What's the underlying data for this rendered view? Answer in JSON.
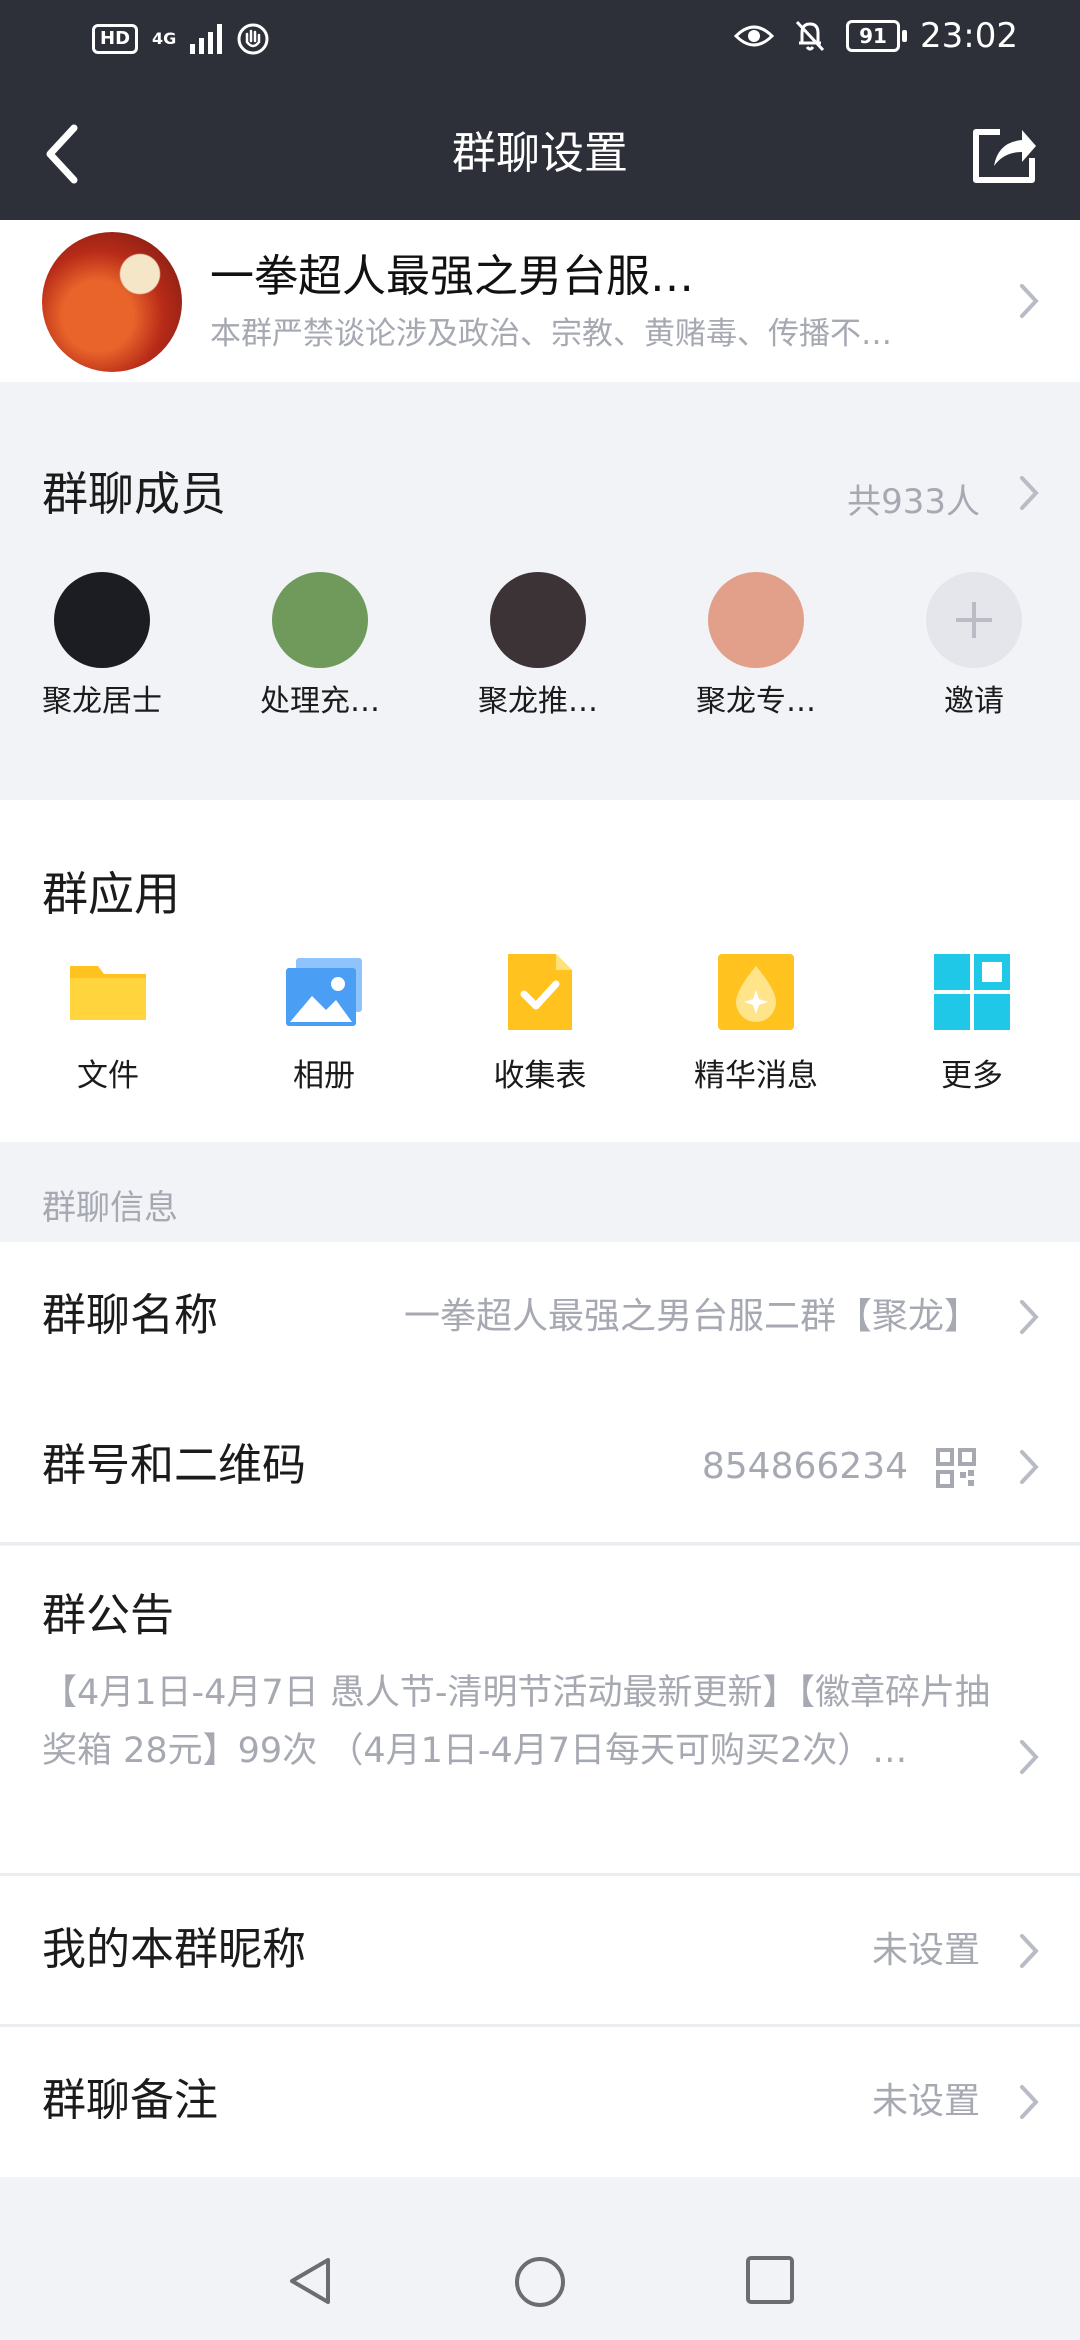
{
  "status_bar": {
    "hd_label": "HD",
    "network_label": "4G",
    "battery_level": "91",
    "time": "23:02",
    "icons": [
      "hd-icon",
      "signal-icon",
      "hand-icon",
      "eye-icon",
      "bell-mute-icon",
      "battery-icon"
    ]
  },
  "header": {
    "title": "群聊设置",
    "back_icon": "back-chevron-icon",
    "share_icon": "share-icon"
  },
  "group": {
    "name": "一拳超人最强之男台服…",
    "description": "本群严禁谈论涉及政治、宗教、黄赌毒、传播不…"
  },
  "members": {
    "label": "群聊成员",
    "count": "共933人",
    "list": [
      {
        "name": "聚龙居士",
        "color": "#1c1d22"
      },
      {
        "name": "处理充…",
        "color": "#6f9a5b"
      },
      {
        "name": "聚龙推…",
        "color": "#3b3336"
      },
      {
        "name": "聚龙专…",
        "color": "#e2a08a"
      }
    ],
    "invite_label": "邀请"
  },
  "apps": {
    "label": "群应用",
    "items": [
      {
        "name": "文件",
        "icon": "folder-icon",
        "color": "#ffc21f"
      },
      {
        "name": "相册",
        "icon": "photo-album-icon",
        "color": "#4a9ff5"
      },
      {
        "name": "收集表",
        "icon": "form-check-icon",
        "color": "#ffc21f"
      },
      {
        "name": "精华消息",
        "icon": "essence-drop-icon",
        "color": "#ffc21f"
      },
      {
        "name": "更多",
        "icon": "grid-more-icon",
        "color": "#1ec8e6"
      }
    ]
  },
  "info": {
    "caption": "群聊信息",
    "group_name_label": "群聊名称",
    "group_name_value": "一拳超人最强之男台服二群【聚龙】",
    "group_id_label": "群号和二维码",
    "group_id_value": "854866234",
    "notice_label": "群公告",
    "notice_text": "【4月1日-4月7日 愚人节-清明节活动最新更新】【徽章碎片抽奖箱 28元】99次 （4月1日-4月7日每天可购买2次）…",
    "nickname_label": "我的本群昵称",
    "nickname_value": "未设置",
    "remark_label": "群聊备注",
    "remark_value": "未设置"
  },
  "nav_bar": {
    "icons": [
      "nav-back-icon",
      "nav-home-icon",
      "nav-recents-icon"
    ]
  }
}
